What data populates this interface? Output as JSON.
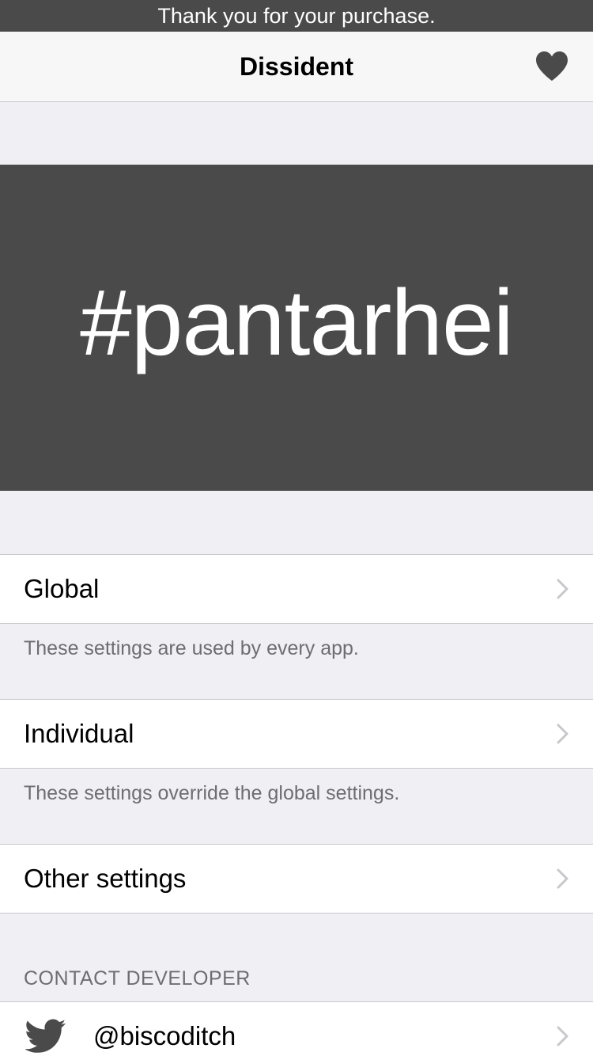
{
  "status_banner": {
    "text": "Thank you for your purchase."
  },
  "navbar": {
    "title": "Dissident",
    "right_icon": "heart-icon"
  },
  "hero": {
    "text": "#pantarhei"
  },
  "settings": {
    "global": {
      "label": "Global",
      "footer": "These settings are used by every app."
    },
    "individual": {
      "label": "Individual",
      "footer": "These settings override the global settings."
    },
    "other": {
      "label": "Other settings"
    }
  },
  "contact": {
    "header": "CONTACT DEVELOPER",
    "twitter_handle": "@biscoditch",
    "icon": "twitter-icon"
  },
  "colors": {
    "banner_bg": "#4a4a4a",
    "hero_bg": "#4a4a4a",
    "background": "#efeff4",
    "chevron": "#c7c7cc"
  }
}
